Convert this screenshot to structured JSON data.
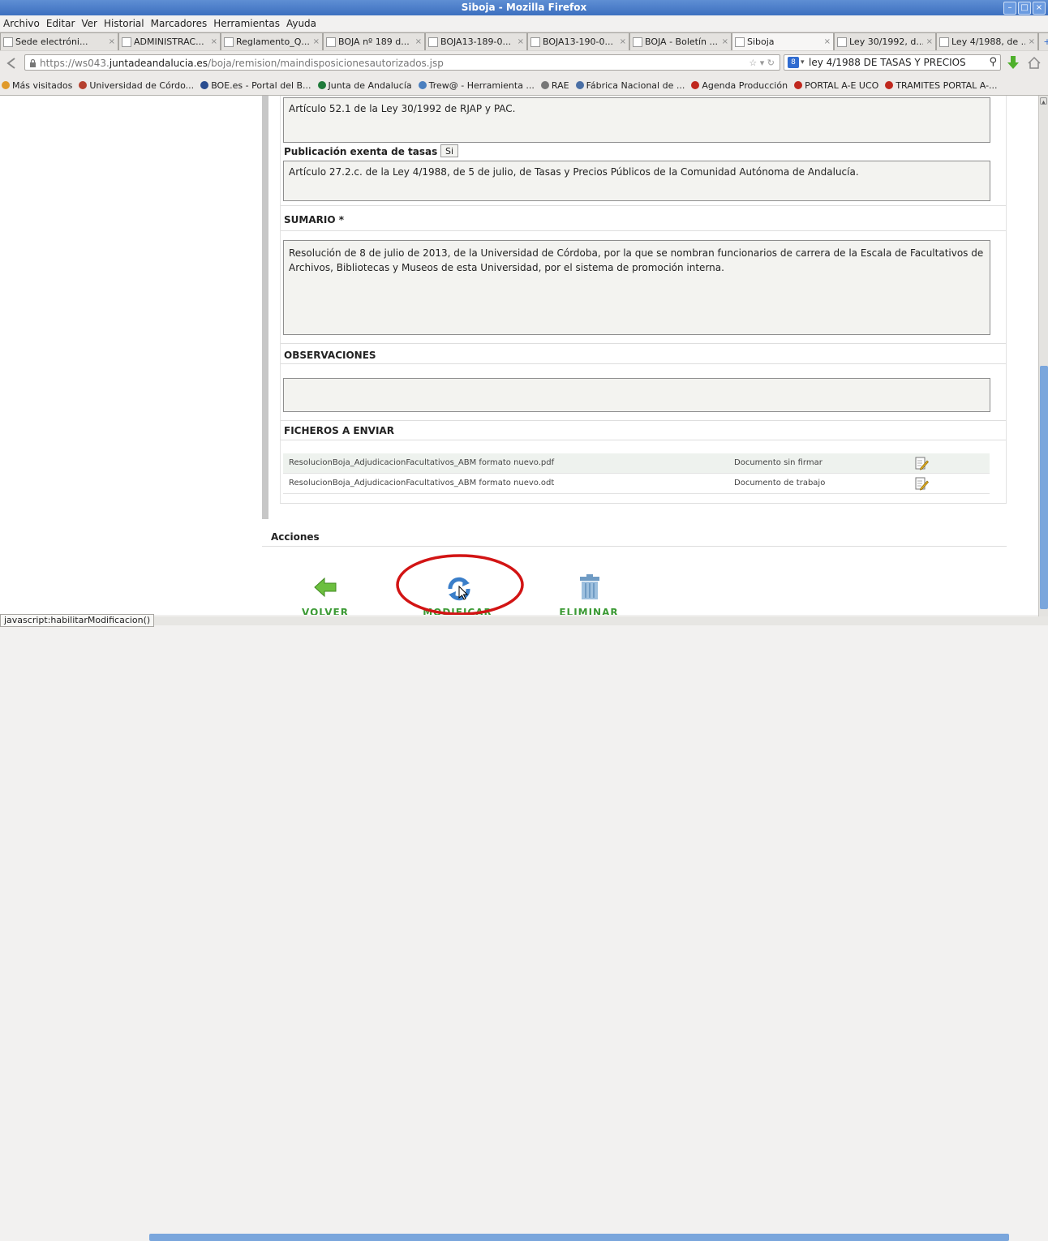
{
  "window": {
    "title": "Siboja - Mozilla Firefox"
  },
  "menu": [
    "Archivo",
    "Editar",
    "Ver",
    "Historial",
    "Marcadores",
    "Herramientas",
    "Ayuda"
  ],
  "tabs": [
    {
      "label": "Sede electróni...",
      "width": 146
    },
    {
      "label": "ADMINISTRAC...",
      "width": 126
    },
    {
      "label": "Reglamento_Q...",
      "width": 126
    },
    {
      "label": "BOJA nº 189 d...",
      "width": 126
    },
    {
      "label": "BOJA13-189-0...",
      "width": 126
    },
    {
      "label": "BOJA13-190-0...",
      "width": 126
    },
    {
      "label": "BOJA - Boletín ...",
      "width": 126
    },
    {
      "label": "Siboja",
      "width": 126,
      "active": true
    },
    {
      "label": "Ley 30/1992, d...",
      "width": 126
    },
    {
      "label": "Ley 4/1988, de ...",
      "width": 126
    }
  ],
  "nav": {
    "url_prefix": "https://ws043.",
    "url_domain": "juntadeandalucia.es",
    "url_path": "/boja/remision/maindisposicionesautorizados.jsp",
    "search_value": "ley 4/1988 DE TASAS Y PRECIOS"
  },
  "bookmarks": [
    {
      "label": "Más visitados",
      "color": "#e09a2a"
    },
    {
      "label": "Universidad de Córdo...",
      "color": "#b5402f"
    },
    {
      "label": "BOE.es - Portal del B...",
      "color": "#2a4d8f"
    },
    {
      "label": "Junta de Andalucía",
      "color": "#1f7a3a"
    },
    {
      "label": "Trew@ - Herramienta ...",
      "color": "#4a7fbf"
    },
    {
      "label": "RAE",
      "color": "#777777"
    },
    {
      "label": "Fábrica Nacional de ...",
      "color": "#4a6fa5"
    },
    {
      "label": "Agenda Producción",
      "color": "#c0281e"
    },
    {
      "label": "PORTAL A-E UCO",
      "color": "#c0281e"
    },
    {
      "label": "TRAMITES PORTAL A-...",
      "color": "#c0281e"
    }
  ],
  "form": {
    "top_field_text": "Artículo 52.1 de la Ley 30/1992 de RJAP y PAC.",
    "exenta_label": "Publicación exenta de tasas :",
    "exenta_value": "Si",
    "exenta_text": "Artículo 27.2.c. de la Ley 4/1988, de 5 de julio, de Tasas y Precios Públicos de la Comunidad Autónoma de Andalucía.",
    "sumario_label": "SUMARIO *",
    "sumario_text": "Resolución de 8 de julio de 2013, de la Universidad de Córdoba, por la que se nombran funcionarios de carrera de la Escala de Facultativos de Archivos, Bibliotecas y Museos de esta Universidad, por el sistema de promoción interna.",
    "observaciones_label": "OBSERVACIONES",
    "observaciones_text": "",
    "ficheros_label": "FICHEROS A ENVIAR",
    "files": [
      {
        "name": "ResolucionBoja_AdjudicacionFacultativos_ABM formato nuevo.pdf",
        "status": "Documento sin firmar"
      },
      {
        "name": "ResolucionBoja_AdjudicacionFacultativos_ABM formato nuevo.odt",
        "status": "Documento de trabajo"
      }
    ]
  },
  "acciones": {
    "label": "Acciones",
    "volver": "VOLVER",
    "modificar": "MODIFICAR",
    "eliminar": "ELIMINAR"
  },
  "status": {
    "text": "javascript:habilitarModificacion()"
  },
  "colors": {
    "accent_green": "#3b9a34",
    "highlight_red": "#d21414"
  }
}
